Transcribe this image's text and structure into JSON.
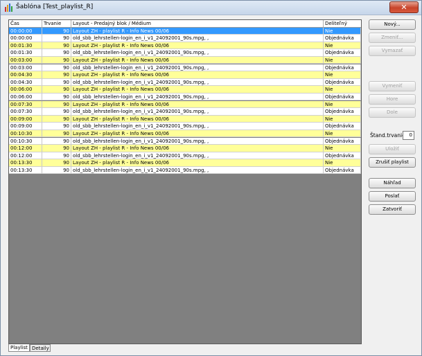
{
  "window": {
    "title": "Šablóna [Test_playlist_R]",
    "close_label": "✕"
  },
  "table": {
    "columns": [
      "Čas",
      "Trvanie",
      "Layout - Predajný blok / Médium",
      "Deliteľný"
    ],
    "rows": [
      {
        "time": "00:00:00",
        "dur": "90",
        "content": "Layout ZH - playlist R - Info News 00/06",
        "div": "Nie",
        "type": "layout",
        "selected": true
      },
      {
        "time": "00:00:00",
        "dur": "90",
        "content": " old_sbb_lehrstellen-login_en_i_v1_24092001_90s.mpg, ,",
        "div": "Objednávka",
        "type": "media"
      },
      {
        "time": "00:01:30",
        "dur": "90",
        "content": "Layout ZH - playlist R - Info News 00/06",
        "div": "Nie",
        "type": "layout"
      },
      {
        "time": "00:01:30",
        "dur": "90",
        "content": " old_sbb_lehrstellen-login_en_i_v1_24092001_90s.mpg, ,",
        "div": "Objednávka",
        "type": "media"
      },
      {
        "time": "00:03:00",
        "dur": "90",
        "content": "Layout ZH - playlist R - Info News 00/06",
        "div": "Nie",
        "type": "layout"
      },
      {
        "time": "00:03:00",
        "dur": "90",
        "content": " old_sbb_lehrstellen-login_en_i_v1_24092001_90s.mpg, ,",
        "div": "Objednávka",
        "type": "media"
      },
      {
        "time": "00:04:30",
        "dur": "90",
        "content": "Layout ZH - playlist R - Info News 00/06",
        "div": "Nie",
        "type": "layout"
      },
      {
        "time": "00:04:30",
        "dur": "90",
        "content": " old_sbb_lehrstellen-login_en_i_v1_24092001_90s.mpg, ,",
        "div": "Objednávka",
        "type": "media"
      },
      {
        "time": "00:06:00",
        "dur": "90",
        "content": "Layout ZH - playlist R - Info News 00/06",
        "div": "Nie",
        "type": "layout"
      },
      {
        "time": "00:06:00",
        "dur": "90",
        "content": " old_sbb_lehrstellen-login_en_i_v1_24092001_90s.mpg, ,",
        "div": "Objednávka",
        "type": "media"
      },
      {
        "time": "00:07:30",
        "dur": "90",
        "content": "Layout ZH - playlist R - Info News 00/06",
        "div": "Nie",
        "type": "layout"
      },
      {
        "time": "00:07:30",
        "dur": "90",
        "content": " old_sbb_lehrstellen-login_en_i_v1_24092001_90s.mpg, ,",
        "div": "Objednávka",
        "type": "media"
      },
      {
        "time": "00:09:00",
        "dur": "90",
        "content": "Layout ZH - playlist R - Info News 00/06",
        "div": "Nie",
        "type": "layout"
      },
      {
        "time": "00:09:00",
        "dur": "90",
        "content": " old_sbb_lehrstellen-login_en_i_v1_24092001_90s.mpg, ,",
        "div": "Objednávka",
        "type": "media"
      },
      {
        "time": "00:10:30",
        "dur": "90",
        "content": "Layout ZH - playlist R - Info News 00/06",
        "div": "Nie",
        "type": "layout"
      },
      {
        "time": "00:10:30",
        "dur": "90",
        "content": " old_sbb_lehrstellen-login_en_i_v1_24092001_90s.mpg, ,",
        "div": "Objednávka",
        "type": "media"
      },
      {
        "time": "00:12:00",
        "dur": "90",
        "content": "Layout ZH - playlist R - Info News 00/06",
        "div": "Nie",
        "type": "layout"
      },
      {
        "time": "00:12:00",
        "dur": "90",
        "content": " old_sbb_lehrstellen-login_en_i_v1_24092001_90s.mpg, ,",
        "div": "Objednávka",
        "type": "media"
      },
      {
        "time": "00:13:30",
        "dur": "90",
        "content": "Layout ZH - playlist R - Info News 00/06",
        "div": "Nie",
        "type": "layout"
      },
      {
        "time": "00:13:30",
        "dur": "90",
        "content": " old_sbb_lehrstellen-login_en_i_v1_24092001_90s.mpg, ,",
        "div": "Objednávka",
        "type": "media"
      }
    ]
  },
  "colors": {
    "layout_row": "#ffff99",
    "media_row": "#ffffff",
    "selected_row": "#3399ff",
    "selected_text": "#ffffff",
    "empty_area": "#808080"
  },
  "buttons": {
    "novy": "Nový...",
    "zmenit": "Zmeniť...",
    "vymazat": "Vymazať",
    "vymenit": "Vymeniť",
    "hore": "Hore",
    "dole": "Dole",
    "ulozit": "Uložiť",
    "zrusit_playlist": "Zrušiť playlist",
    "nahlad": "Náhľad",
    "poslat": "Poslať",
    "zatvorit": "Zatvoriť"
  },
  "stand_trvanie": {
    "label": "Štand.trvanie",
    "value": "0"
  },
  "tabs": [
    "Playlist",
    "Detaily"
  ]
}
